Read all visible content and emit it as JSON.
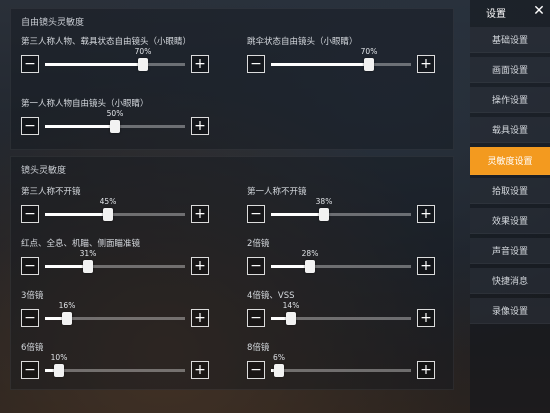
{
  "free_camera": {
    "title": "自由镜头灵敏度",
    "items": [
      {
        "label": "第三人称人物、载具状态自由镜头（小眼睛）",
        "value_text": "70%",
        "value": 70
      },
      {
        "label": "跳伞状态自由镜头（小眼睛）",
        "value_text": "70%",
        "value": 70
      },
      {
        "label": "第一人称人物自由镜头（小眼睛）",
        "value_text": "50%",
        "value": 50
      }
    ]
  },
  "camera": {
    "title": "镜头灵敏度",
    "items": [
      {
        "label": "第三人称不开镜",
        "value_text": "45%",
        "value": 45
      },
      {
        "label": "第一人称不开镜",
        "value_text": "38%",
        "value": 38
      },
      {
        "label": "红点、全息、机瞄、侧面瞄准镜",
        "value_text": "31%",
        "value": 31
      },
      {
        "label": "2倍镜",
        "value_text": "28%",
        "value": 28
      },
      {
        "label": "3倍镜",
        "value_text": "16%",
        "value": 16
      },
      {
        "label": "4倍镜、VSS",
        "value_text": "14%",
        "value": 14
      },
      {
        "label": "6倍镜",
        "value_text": "10%",
        "value": 10
      },
      {
        "label": "8倍镜",
        "value_text": "6%",
        "value": 6
      }
    ]
  },
  "buttons": {
    "minus": "−",
    "plus": "+"
  },
  "sidebar": {
    "title": "设置",
    "close": "✕",
    "items": [
      {
        "label": "基础设置",
        "active": false
      },
      {
        "label": "画面设置",
        "active": false
      },
      {
        "label": "操作设置",
        "active": false
      },
      {
        "label": "载具设置",
        "active": false
      },
      {
        "label": "灵敏度设置",
        "active": true
      },
      {
        "label": "拾取设置",
        "active": false
      },
      {
        "label": "效果设置",
        "active": false
      },
      {
        "label": "声音设置",
        "active": false
      },
      {
        "label": "快捷消息",
        "active": false
      },
      {
        "label": "录像设置",
        "active": false
      }
    ]
  },
  "colors": {
    "accent": "#f39a1f"
  }
}
